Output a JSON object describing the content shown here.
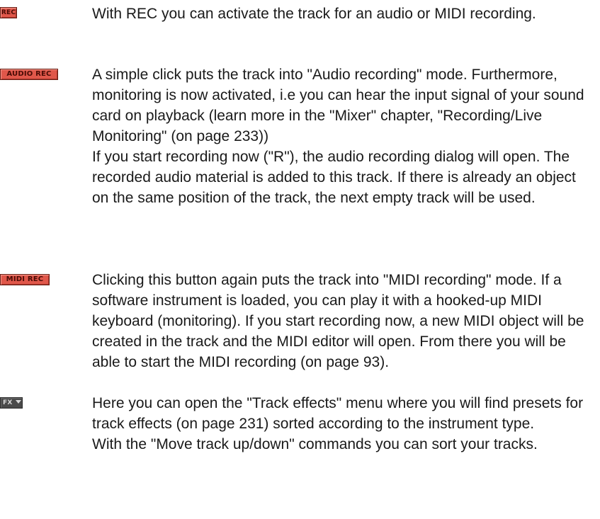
{
  "entries": [
    {
      "button_label": "REC",
      "paragraphs": [
        "With REC you can activate the track for an audio or MIDI recording."
      ]
    },
    {
      "button_label": "AUDIO REC",
      "paragraphs": [
        "A simple click puts the track into \"Audio recording\" mode. Furthermore, monitoring is now activated, i.e you can hear the input signal of your sound card on playback (learn more in the \"Mixer\" chapter, \"Recording/Live Monitoring\" (on page 233))",
        "If you start recording now (\"R\"), the audio recording dialog will open. The recorded audio material is added to this track. If there is already an object on the same position of the track, the next empty track will be used."
      ]
    },
    {
      "button_label": "MIDI REC",
      "paragraphs": [
        "Clicking this button again puts the track into \"MIDI recording\" mode. If a software instrument is loaded, you can play it with a hooked-up MIDI keyboard (monitoring). If you start recording now, a new MIDI object will be created in the track and the MIDI editor will open. From there you will be able to start the MIDI recording (on page 93)."
      ]
    },
    {
      "button_label": "FX",
      "button_icon": "dropdown-arrow-icon",
      "paragraphs": [
        "Here you can open the \"Track effects\" menu where you will find presets for track effects (on page 231) sorted according to the instrument type.",
        "With the \"Move track up/down\" commands you can sort your tracks."
      ]
    }
  ],
  "colors": {
    "rec_button": "#e0574a",
    "fx_button": "#4a4a4a",
    "text": "#1a1a1a"
  }
}
